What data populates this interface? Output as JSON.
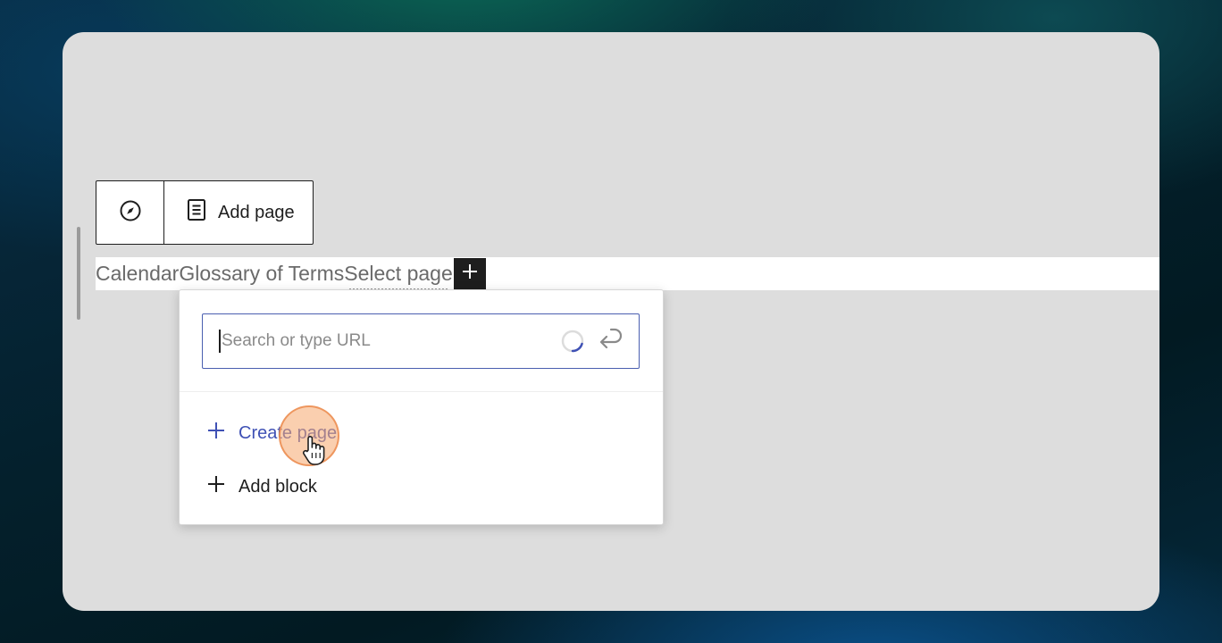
{
  "toolbar": {
    "compass_icon": "compass-icon",
    "page_icon": "page-icon",
    "add_page_label": "Add page"
  },
  "nav": {
    "items": [
      "Calendar",
      "Glossary of Terms"
    ],
    "select_page_label": "Select page",
    "plus_icon": "plus-icon"
  },
  "popover": {
    "search_placeholder": "Search or type URL",
    "search_value": "",
    "spinner_icon": "spinner-icon",
    "enter_icon": "enter-icon",
    "create_page_label": "Create page",
    "add_block_label": "Add block"
  },
  "colors": {
    "accent": "#3f51b5",
    "canvas": "#dddddd",
    "dark": "#1e1e1e",
    "cursor_highlight": "#f6a86e"
  }
}
